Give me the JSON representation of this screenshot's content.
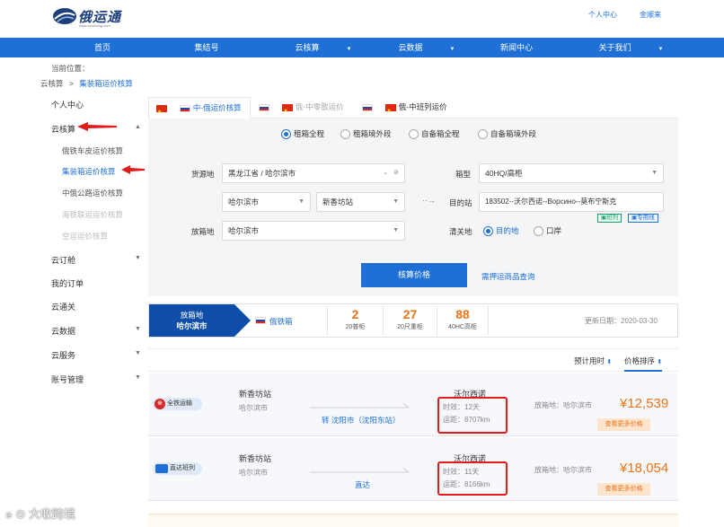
{
  "header": {
    "logo_text": "俄运通",
    "logo_sub": "www.eyuntong.com",
    "personal_center": "个人中心",
    "user_name": "金顺来"
  },
  "nav": {
    "items": [
      {
        "label": "首页"
      },
      {
        "label": "集结号"
      },
      {
        "label": "云核算",
        "caret": "▼"
      },
      {
        "label": "云数据",
        "caret": "▼"
      },
      {
        "label": "新闻中心"
      },
      {
        "label": "关于我们",
        "caret": "▼"
      }
    ]
  },
  "breadcrumb": {
    "prefix": "当前位置：",
    "parent": "云核算",
    "separator": ">",
    "current": "集装箱运价核算"
  },
  "sidebar": {
    "items": [
      {
        "label": "个人中心"
      },
      {
        "label": "云核算",
        "caret": "▲"
      },
      {
        "label": "俄铁车皮运价核算"
      },
      {
        "label": "集装箱运价核算"
      },
      {
        "label": "中俄公路运价核算"
      },
      {
        "label": "海铁联运运价核算"
      },
      {
        "label": "空运运价核算"
      },
      {
        "label": "云订舱",
        "caret": "▼"
      },
      {
        "label": "我的订单"
      },
      {
        "label": "云通关"
      },
      {
        "label": "云数据",
        "caret": "▼"
      },
      {
        "label": "云服务",
        "caret": "▼"
      },
      {
        "label": "账号管理",
        "caret": "▼"
      }
    ]
  },
  "tabs": [
    {
      "label": "中-俄运价核算"
    },
    {
      "label": "俄-中零散运价"
    },
    {
      "label": "俄-中班列运价"
    }
  ],
  "form": {
    "radio_options": [
      {
        "label": "租箱全程"
      },
      {
        "label": "租箱境外段"
      },
      {
        "label": "自备箱全程"
      },
      {
        "label": "自备箱境外段"
      }
    ],
    "origin_label": "货源地",
    "origin_value": "黑龙江省 / 哈尔滨市",
    "origin_city": "哈尔滨市",
    "origin_station": "新香坊站",
    "return_label": "放箱地",
    "return_value": "哈尔滨市",
    "box_label": "箱型",
    "box_value": "40HQ/高柜",
    "dest_label": "目的站",
    "dest_value": "183502--沃尔西诺--Ворсино--莫布宁斯克",
    "badge_train": "班列",
    "badge_line": "专用线",
    "clear_label": "清关地",
    "clear_options": [
      {
        "label": "目的地"
      },
      {
        "label": "口岸"
      }
    ],
    "submit_label": "核算价格",
    "deposit_link": "需押运商品查询"
  },
  "summary": {
    "return_label": "放箱地",
    "return_city": "哈尔滨市",
    "rail_label": "俄铁箱",
    "counts": [
      {
        "value": "2",
        "label": "20普柜"
      },
      {
        "value": "27",
        "label": "20尺重柜"
      },
      {
        "value": "88",
        "label": "40HC高柜"
      }
    ],
    "update_date": "更新日期：2020-03-30"
  },
  "sort": {
    "eta_label": "预计用时",
    "price_label": "价格排序"
  },
  "results": [
    {
      "badge": "全铁运输",
      "from_station": "新香坊站",
      "from_city": "哈尔滨市",
      "route": "转 沈阳市（沈阳东站）",
      "to_station": "沃尔西诺",
      "duration": "时效：12天",
      "distance": "运距：8707km",
      "return_place": "放箱地：哈尔滨市",
      "price": "¥12,539",
      "more_label": "查看更多价格"
    },
    {
      "badge": "直达班列",
      "from_station": "新香坊站",
      "from_city": "哈尔滨市",
      "route": "直达",
      "to_station": "沃尔西诺",
      "duration": "时效：11天",
      "distance": "运距：8166km",
      "return_place": "放箱地：哈尔滨市",
      "price": "¥18,054",
      "more_label": "查看更多价格"
    }
  ],
  "watermark": "大收跨境",
  "colors": {
    "primary": "#1e6fd6",
    "dark_blue": "#0e4ea8",
    "accent_orange": "#e8741a",
    "annotation_red": "#e21b1b"
  }
}
